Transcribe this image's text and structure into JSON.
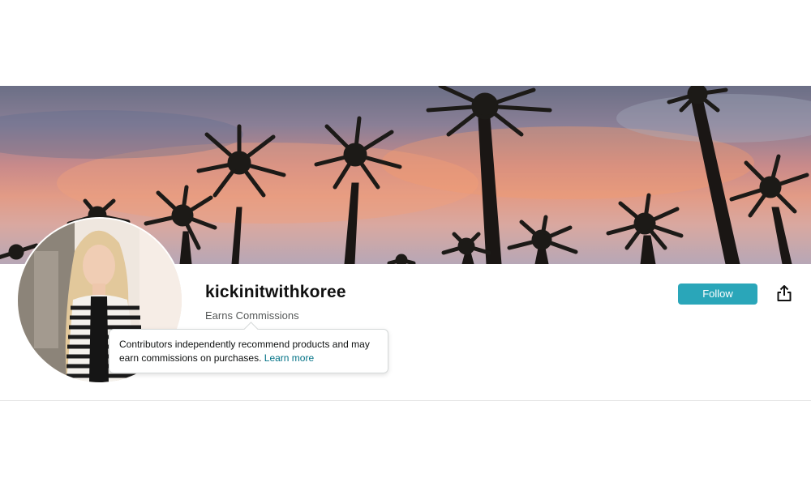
{
  "profile": {
    "username": "kickinitwithkoree",
    "earns_label": "Earns Commissions",
    "follow_label": "Follow",
    "share_icon": "share-icon"
  },
  "tooltip": {
    "text": "Contributors independently recommend products and may earn commissions on purchases.",
    "link_label": "Learn more"
  },
  "colors": {
    "follow_button": "#2aa6b9",
    "link": "#007185"
  }
}
